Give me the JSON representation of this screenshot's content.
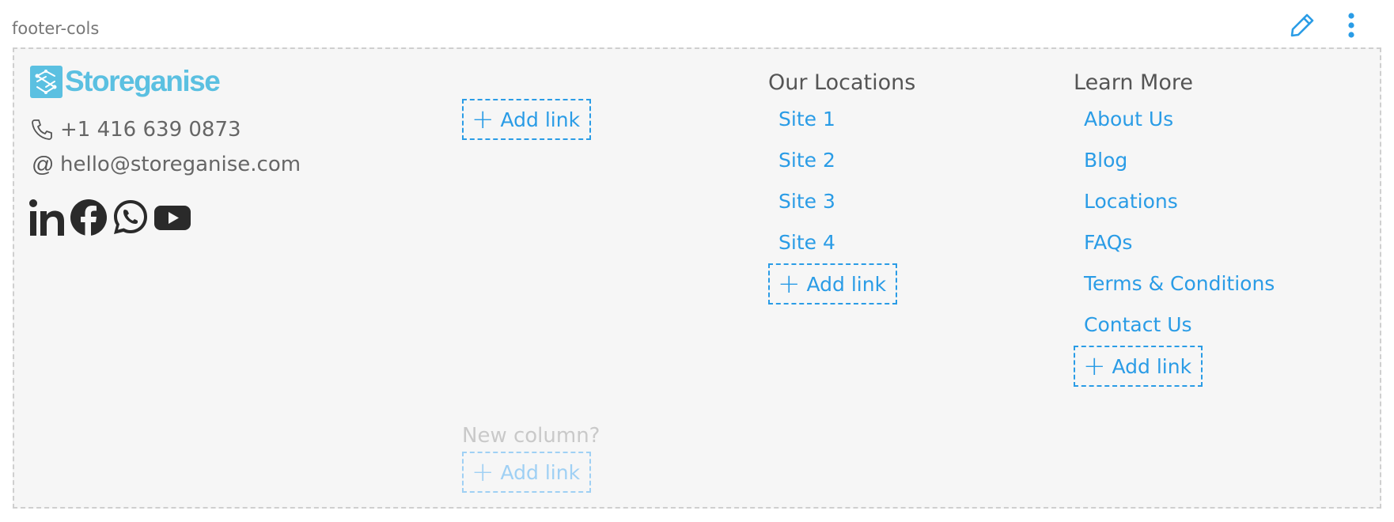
{
  "section": {
    "label": "footer-cols"
  },
  "toolbar": {
    "edit_icon": "pencil-icon",
    "more_icon": "vertical-dots-icon",
    "accent": "#2a9ce6"
  },
  "brand": {
    "name": "Storeganise",
    "color": "#5bc0e1"
  },
  "contact": {
    "phone": "+1 416 639 0873",
    "email": "hello@storeganise.com"
  },
  "social": [
    "linkedin-icon",
    "facebook-icon",
    "whatsapp-icon",
    "youtube-icon"
  ],
  "columns": [
    {
      "title": "",
      "links": [],
      "add_label": "Add link"
    },
    {
      "title": "Our Locations",
      "links": [
        "Site 1",
        "Site 2",
        "Site 3",
        "Site 4"
      ],
      "add_label": "Add link"
    },
    {
      "title": "Learn More",
      "links": [
        "About Us",
        "Blog",
        "Locations",
        "FAQs",
        "Terms & Conditions",
        "Contact Us"
      ],
      "add_label": "Add link"
    }
  ],
  "new_column": {
    "prompt": "New column?",
    "add_label": "Add link"
  },
  "colors": {
    "link": "#2a9ce6",
    "muted_link": "#9fd0f4",
    "box_bg": "#f6f6f6",
    "border": "#cfcfcf"
  }
}
